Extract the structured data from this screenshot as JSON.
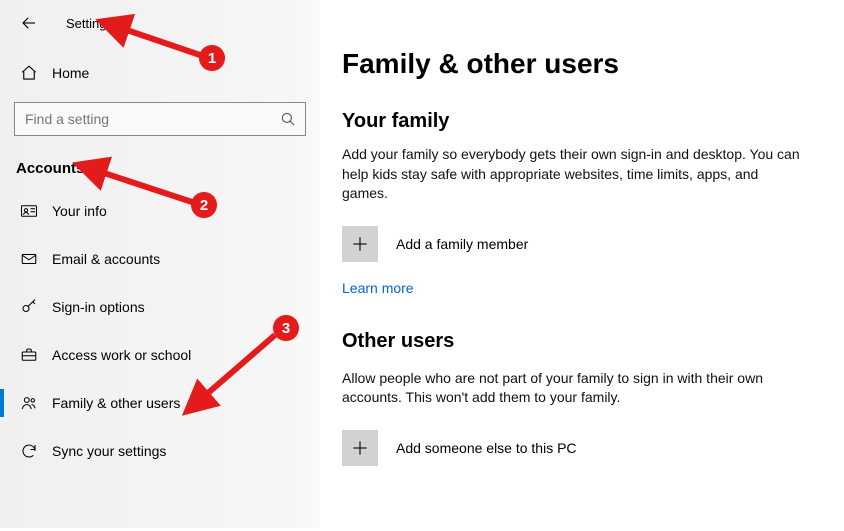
{
  "window": {
    "title": "Settings"
  },
  "sidebar": {
    "home_label": "Home",
    "search_placeholder": "Find a setting",
    "section_title": "Accounts",
    "items": [
      {
        "label": "Your info"
      },
      {
        "label": "Email & accounts"
      },
      {
        "label": "Sign-in options"
      },
      {
        "label": "Access work or school"
      },
      {
        "label": "Family & other users"
      },
      {
        "label": "Sync your settings"
      }
    ]
  },
  "main": {
    "title": "Family & other users",
    "family": {
      "heading": "Your family",
      "description": "Add your family so everybody gets their own sign-in and desktop. You can help kids stay safe with appropriate websites, time limits, apps, and games.",
      "add_label": "Add a family member",
      "learn_more": "Learn more"
    },
    "other": {
      "heading": "Other users",
      "description": "Allow people who are not part of your family to sign in with their own accounts. This won't add them to your family.",
      "add_label": "Add someone else to this PC"
    }
  },
  "annotations": {
    "b1": "1",
    "b2": "2",
    "b3": "3"
  }
}
